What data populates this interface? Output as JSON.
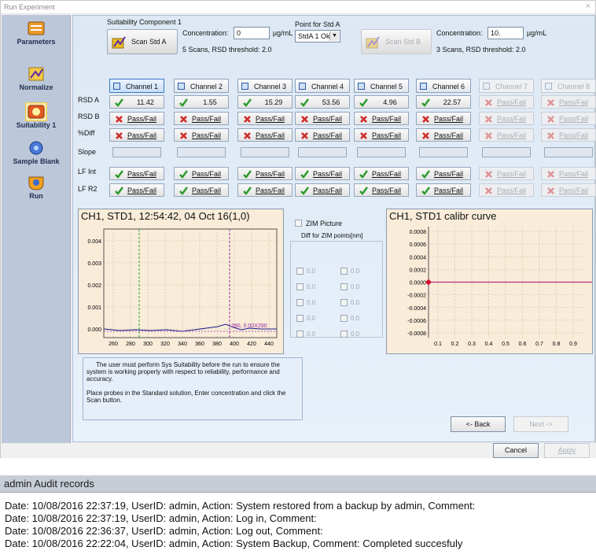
{
  "window": {
    "title": "Run Experiment",
    "close_glyph": "×"
  },
  "sidebar": {
    "items": [
      {
        "label": "Parameters",
        "icon": "parameters-icon"
      },
      {
        "label": "Normalize",
        "icon": "normalize-icon"
      },
      {
        "label": "Suitability 1",
        "icon": "suitability-icon"
      },
      {
        "label": "Sample Blank",
        "icon": "sample-blank-icon"
      },
      {
        "label": "Run",
        "icon": "run-icon"
      }
    ]
  },
  "std_a": {
    "group_label": "Suitability Component 1",
    "scan_label": "Scan Std A",
    "conc_label": "Concentration:",
    "conc_value": "0",
    "unit": "µg/mL",
    "scans_text": "5 Scans, RSD threshold: 2.0"
  },
  "point": {
    "label": "Point for Std A",
    "selected": "StdA 1 Ok"
  },
  "std_b": {
    "scan_label": "Scan Std B",
    "conc_label": "Concentration:",
    "conc_value": "10.",
    "unit": "µg/mL",
    "scans_text": "3 Scans, RSD threshold: 2.0"
  },
  "channels": [
    "Channel 1",
    "Channel 2",
    "Channel 3",
    "Channel 4",
    "Channel 5",
    "Channel 6",
    "Channel 7",
    "Channel 8"
  ],
  "row_labels": {
    "rsd_a": "RSD A",
    "rsd_b": "RSD B",
    "pdiff": "%Diff",
    "slope": "Slope",
    "lf_int": "LF Int",
    "lf_r2": "LF R2"
  },
  "rsd_a": [
    "11.42",
    "1.55",
    "15.29",
    "53.56",
    "4.96",
    "22.57",
    "Pass/Fail",
    "Pass/Fail"
  ],
  "pass_fail": "Pass/Fail",
  "chart1": {
    "title": "CH1, STD1, 12:54:42, 04 Oct 16(1,0)",
    "yticks": [
      "0.004",
      "0.003",
      "0.002",
      "0.001",
      "0.000"
    ],
    "xticks": [
      "260",
      "280",
      "300",
      "320",
      "340",
      "360",
      "380",
      "400",
      "420",
      "440"
    ],
    "annotation": "390, 0.00X290",
    "colors": {
      "line": "#1a1a8a",
      "cursor_green": "#2aa02a",
      "cursor_purple": "#9a2aa8",
      "bg": "#f9ecd9"
    }
  },
  "zim": {
    "picture_label": "ZIM Picture",
    "diff_label": "Diff for ZIM points[nm]",
    "value": "0.0"
  },
  "chart2": {
    "title": "CH1, STD1 calibr curve",
    "yticks": [
      "0.0008",
      "0.0006",
      "0.0004",
      "0.0002",
      "0.0000",
      "-0.0002",
      "-0.0004",
      "-0.0006",
      "-0.0008"
    ],
    "xticks": [
      "0.1",
      "0.2",
      "0.3",
      "0.4",
      "0.5",
      "0.6",
      "0.7",
      "0.8",
      "0.9"
    ],
    "colors": {
      "line": "#b0307a",
      "point": "#d01030"
    }
  },
  "info": {
    "p1": "The user must perform Sys Suitability before the run to ensure the system is working properly with respect to reliability, performance and accuracy.",
    "p2": "Place probes in the Standard solution, Enter concentration  and click the Scan  button."
  },
  "nav": {
    "back": "<- Back",
    "next": "Next ->"
  },
  "footer": {
    "cancel": "Cancel",
    "apply": "Apply"
  },
  "audit": {
    "title": "admin Audit records",
    "lines": [
      "Date: 10/08/2016 22:37:19, UserID: admin, Action: System restored from a backup by admin, Comment:",
      "Date: 10/08/2016 22:37:19, UserID: admin, Action: Log in, Comment:",
      "Date: 10/08/2016 22:36:37, UserID: admin, Action: Log out, Comment:",
      "Date: 10/08/2016 22:22:04, UserID: admin, Action: System Backup, Comment: Completed succesfuly"
    ]
  }
}
